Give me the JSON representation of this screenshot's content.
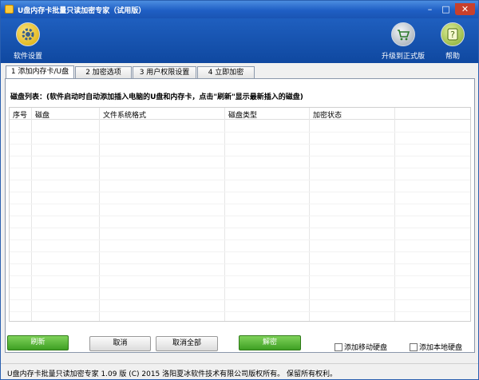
{
  "window": {
    "title": "U盘内存卡批量只读加密专家（试用版）",
    "minimize_glyph": "–",
    "maximize_glyph": "□",
    "close_glyph": "✕"
  },
  "toolbar": {
    "settings_label": "软件设置",
    "settings_icon": "gear-icon",
    "upgrade_label": "升级到正式版",
    "upgrade_icon": "cart-icon",
    "help_label": "帮助",
    "help_icon": "help-icon"
  },
  "tabs": [
    {
      "label": "1 添加内存卡/U盘",
      "active": true
    },
    {
      "label": "2 加密选项",
      "active": false
    },
    {
      "label": "3 用户权限设置",
      "active": false
    },
    {
      "label": "4 立即加密",
      "active": false
    }
  ],
  "disk_list": {
    "label": "磁盘列表：(软件启动时自动添加插入电脑的U盘和内存卡，点击\"刷新\"显示最新插入的磁盘)"
  },
  "table": {
    "columns": [
      "序号",
      "磁盘",
      "文件系统格式",
      "磁盘类型",
      "加密状态"
    ]
  },
  "actions": {
    "refresh": "刷新",
    "cancel": "取消",
    "cancel_all": "取消全部",
    "decrypt": "解密",
    "add_removable": "添加移动硬盘",
    "add_local": "添加本地硬盘"
  },
  "status": {
    "text": "U盘内存卡批量只读加密专家 1.09 版 (C) 2015 洛阳夏冰软件技术有限公司版权所有。 保留所有权利。"
  },
  "colors": {
    "title_blue": "#1f5fc4",
    "toolbar_blue": "#0f48a0",
    "button_green": "#3e9f23"
  }
}
